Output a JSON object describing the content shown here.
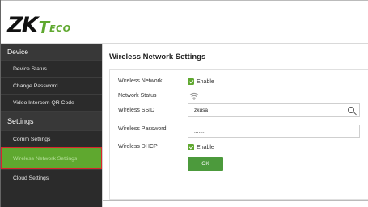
{
  "brand": {
    "logo_zk": "ZK",
    "logo_t": "T",
    "logo_eco": "ECO"
  },
  "sidebar": {
    "device_header": "Device",
    "device_items": [
      {
        "label": "Device Status"
      },
      {
        "label": "Change Password"
      },
      {
        "label": "Video Intercom QR Code"
      }
    ],
    "settings_header": "Settings",
    "settings_items": [
      {
        "label": "Comm Settings"
      },
      {
        "label": "Wireless Network Settings",
        "active": true
      },
      {
        "label": "Cloud Settings"
      }
    ]
  },
  "main": {
    "title": "Wireless Network Settings",
    "wireless_network": {
      "label": "Wireless Network",
      "checkbox_label": "Enable",
      "checked": true
    },
    "network_status": {
      "label": "Network Status",
      "icon": "wifi-icon"
    },
    "ssid": {
      "label": "Wireless SSID",
      "value": "zkusa",
      "icon": "search-icon"
    },
    "password": {
      "label": "Wireless Password",
      "value": "........"
    },
    "dhcp": {
      "label": "Wireless DHCP",
      "checkbox_label": "Enable",
      "checked": true
    },
    "ok_label": "OK"
  },
  "colors": {
    "accent": "#5fa82f",
    "sidebar_bg": "#2b2b2b",
    "active_outline": "#d9262c",
    "ok_button": "#4c9a3c"
  }
}
